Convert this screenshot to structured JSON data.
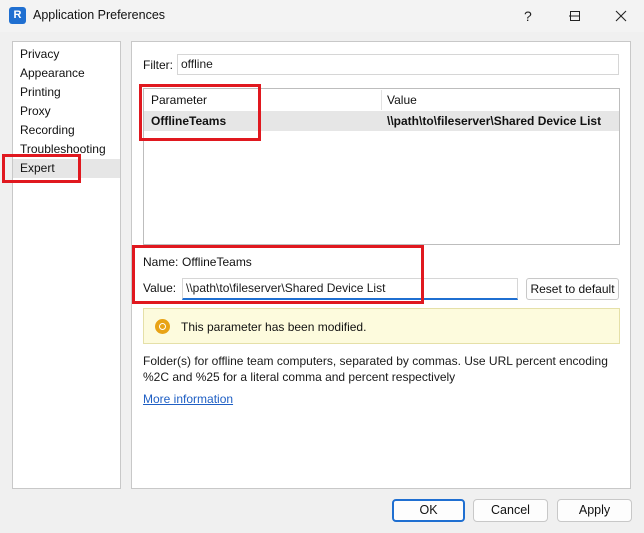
{
  "window": {
    "title": "Application Preferences",
    "app_icon_label": "R",
    "controls": [
      "help-icon",
      "minimize-icon",
      "maximize-icon",
      "close-icon"
    ]
  },
  "categories": [
    {
      "label": "Privacy",
      "selected": false
    },
    {
      "label": "Appearance",
      "selected": false
    },
    {
      "label": "Printing",
      "selected": false
    },
    {
      "label": "Proxy",
      "selected": false
    },
    {
      "label": "Recording",
      "selected": false
    },
    {
      "label": "Troubleshooting",
      "selected": false
    },
    {
      "label": "Expert",
      "selected": true
    }
  ],
  "filter": {
    "label": "Filter:",
    "value": "offline"
  },
  "table": {
    "headers": [
      "Parameter",
      "Value"
    ],
    "rows": [
      {
        "parameter": "OfflineTeams",
        "value": "\\\\path\\to\\fileserver\\Shared Device List"
      }
    ]
  },
  "detail": {
    "name_label": "Name:",
    "name_value": "OfflineTeams",
    "value_label": "Value:",
    "value_value": "\\\\path\\to\\fileserver\\Shared Device List",
    "reset_button": "Reset to default"
  },
  "notice": {
    "text": "This parameter has been modified.",
    "icon": "warning-icon"
  },
  "description": "Folder(s) for offline team computers, separated by commas. Use URL percent encoding %2C and %25 for a literal comma and percent respectively",
  "more_link": "More information",
  "buttons": {
    "ok": "OK",
    "cancel": "Cancel",
    "apply": "Apply"
  },
  "colors": {
    "highlight": "#e0181f",
    "accent": "#1f6fd1",
    "notice_bg": "#fdfbdd",
    "link": "#1f5fc4"
  }
}
